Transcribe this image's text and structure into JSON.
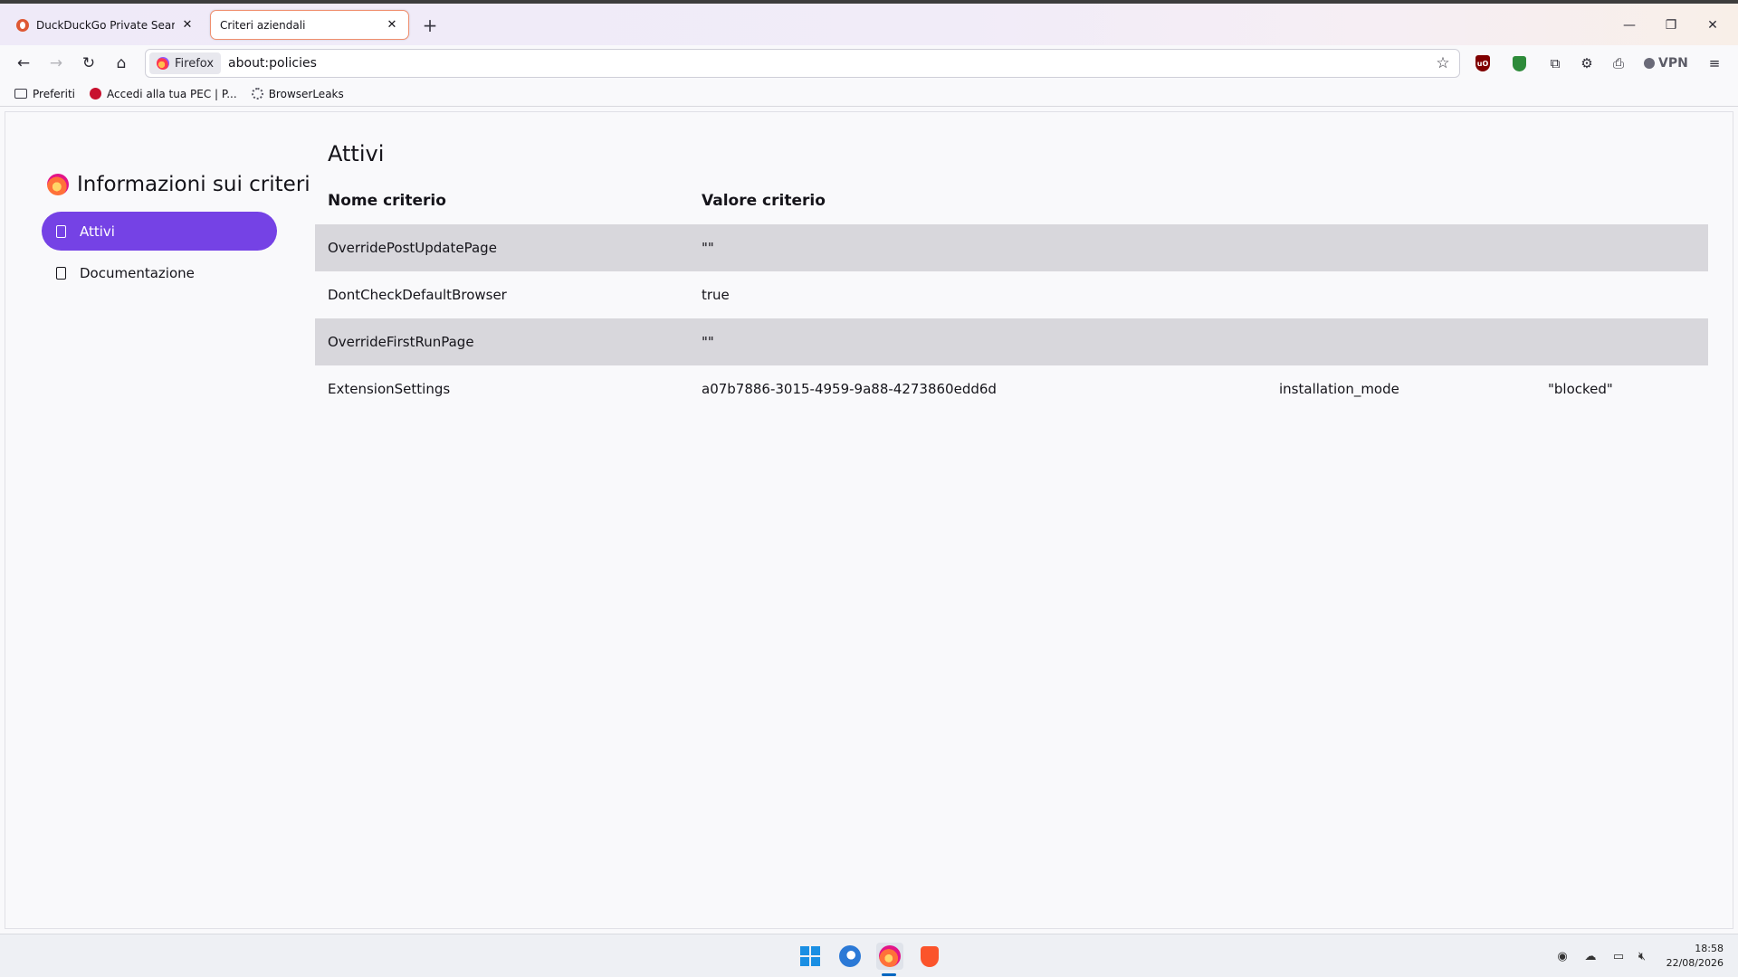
{
  "browser": {
    "tabs": [
      {
        "title": "DuckDuckGo Private Search Engine",
        "active": false
      },
      {
        "title": "Criteri aziendali",
        "active": true
      }
    ],
    "identity_label": "Firefox",
    "url": "about:policies",
    "vpn_label": "VPN"
  },
  "bookmarks": [
    {
      "label": "Preferiti",
      "icon": "folder-icon"
    },
    {
      "label": "Accedi alla tua PEC | P...",
      "icon": "pec-favicon"
    },
    {
      "label": "BrowserLeaks",
      "icon": "fingerprint-icon"
    }
  ],
  "sidebar": {
    "title": "Informazioni sui criteri",
    "items": [
      {
        "label": "Attivi",
        "active": true
      },
      {
        "label": "Documentazione",
        "active": false
      }
    ]
  },
  "main": {
    "title": "Attivi",
    "columns": [
      "Nome criterio",
      "Valore criterio"
    ],
    "rows": [
      {
        "name": "OverridePostUpdatePage",
        "value": "\"\"",
        "sub_key": "",
        "sub_value": ""
      },
      {
        "name": "DontCheckDefaultBrowser",
        "value": "true",
        "sub_key": "",
        "sub_value": ""
      },
      {
        "name": "OverrideFirstRunPage",
        "value": "\"\"",
        "sub_key": "",
        "sub_value": ""
      },
      {
        "name": "ExtensionSettings",
        "value": "a07b7886-3015-4959-9a88-4273860edd6d",
        "sub_key": "installation_mode",
        "sub_value": "\"blocked\""
      }
    ]
  },
  "taskbar": {
    "time": "18:58",
    "date": "22/08/2026"
  },
  "colors": {
    "accent": "#7542e5",
    "row_shade": "#d8d7dc"
  }
}
